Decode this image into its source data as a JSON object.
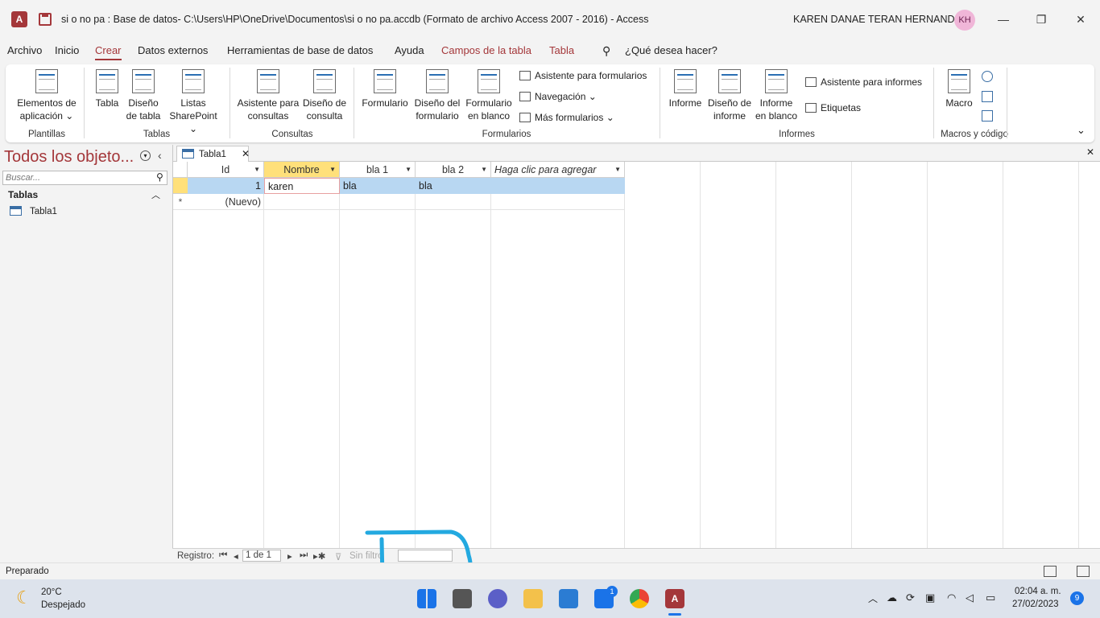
{
  "titlebar": {
    "app_icon": "access-app-icon",
    "title": "si o no pa : Base de datos- C:\\Users\\HP\\OneDrive\\Documentos\\si o no pa.accdb (Formato de archivo Access 2007 - 2016)  -  Access",
    "user_name": "KAREN DANAE TERAN HERNANDEZ",
    "avatar_initials": "KH",
    "minimize": "—",
    "restore": "❐",
    "close": "✕"
  },
  "menu": {
    "items": [
      "Archivo",
      "Inicio",
      "Crear",
      "Datos externos",
      "Herramientas de base de datos",
      "Ayuda",
      "Campos de la tabla",
      "Tabla"
    ],
    "active": "Crear",
    "search_label": "¿Qué desea hacer?"
  },
  "ribbon": {
    "plantillas": {
      "btn": "Elementos de aplicación ⌄",
      "btn_l1": "Elementos de",
      "btn_l2": "aplicación ⌄",
      "label": "Plantillas"
    },
    "tablas": {
      "tabla": "Tabla",
      "diseno_l1": "Diseño",
      "diseno_l2": "de tabla",
      "listas_l1": "Listas",
      "listas_l2": "SharePoint ⌄",
      "label": "Tablas"
    },
    "consultas": {
      "asistente_l1": "Asistente para",
      "asistente_l2": "consultas",
      "diseno_l1": "Diseño de",
      "diseno_l2": "consulta",
      "label": "Consultas"
    },
    "formularios": {
      "formulario": "Formulario",
      "diseno_l1": "Diseño del",
      "diseno_l2": "formulario",
      "blanco_l1": "Formulario",
      "blanco_l2": "en blanco",
      "asistente": "Asistente para formularios",
      "navegacion": "Navegación ⌄",
      "mas": "Más formularios ⌄",
      "label": "Formularios"
    },
    "informes": {
      "informe": "Informe",
      "diseno_l1": "Diseño de",
      "diseno_l2": "informe",
      "blanco_l1": "Informe",
      "blanco_l2": "en blanco",
      "asistente": "Asistente para informes",
      "etiquetas": "Etiquetas",
      "label": "Informes"
    },
    "macros": {
      "macro": "Macro",
      "label": "Macros y código"
    },
    "collapse_icon": "⌄"
  },
  "navpane": {
    "title": "Todos los objeto...",
    "search_placeholder": "Buscar...",
    "section": "Tablas",
    "objects": [
      "Tabla1"
    ]
  },
  "document": {
    "tab_label": "Tabla1",
    "columns": [
      "Id",
      "Nombre",
      "bla 1",
      "bla 2",
      "Haga clic para agregar"
    ],
    "rows": [
      {
        "id": "1",
        "nombre": "karen",
        "bla1": "bla",
        "bla2": "bla"
      }
    ],
    "new_row_label": "(Nuevo)"
  },
  "record_nav": {
    "label": "Registro:",
    "position": "1 de 1",
    "filter": "Sin filtro"
  },
  "status": {
    "text": "Preparado"
  },
  "taskbar": {
    "weather_temp": "20°C",
    "weather_desc": "Despejado",
    "time": "02:04 a. m.",
    "date": "27/02/2023",
    "mail_badge": "1",
    "notif_count": "9"
  },
  "colors": {
    "access_red": "#a4373a",
    "selected_row": "#b8d7f2",
    "selected_header": "#ffe07a",
    "annotation_cyan": "#23a9e0"
  }
}
